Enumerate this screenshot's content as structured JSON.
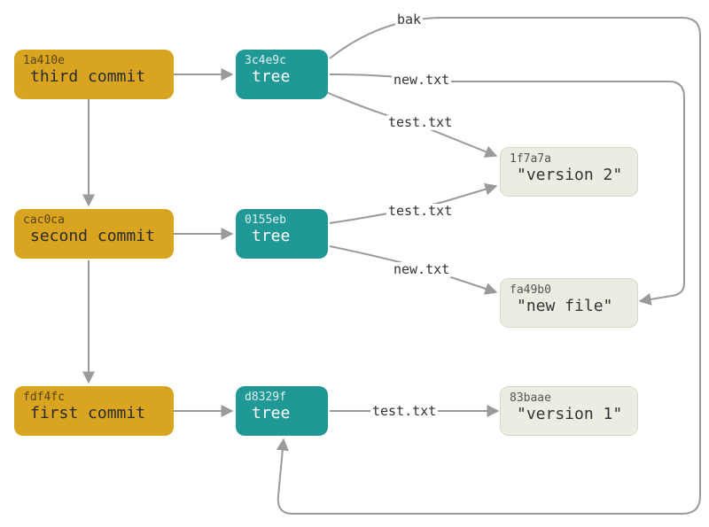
{
  "colors": {
    "commit": "#d9a521",
    "tree": "#209896",
    "blob": "#ecece3",
    "arrow": "#9a9a9a"
  },
  "nodes": {
    "commit3": {
      "hash": "1a410e",
      "title": "third commit"
    },
    "commit2": {
      "hash": "cac0ca",
      "title": "second commit"
    },
    "commit1": {
      "hash": "fdf4fc",
      "title": "first commit"
    },
    "tree3": {
      "hash": "3c4e9c",
      "title": "tree"
    },
    "tree2": {
      "hash": "0155eb",
      "title": "tree"
    },
    "tree1": {
      "hash": "d8329f",
      "title": "tree"
    },
    "blob_v2": {
      "hash": "1f7a7a",
      "title": "\"version 2\""
    },
    "blob_nf": {
      "hash": "fa49b0",
      "title": "\"new file\""
    },
    "blob_v1": {
      "hash": "83baae",
      "title": "\"version 1\""
    }
  },
  "labels": {
    "bak": "bak",
    "new_txt": "new.txt",
    "test_txt": "test.txt"
  }
}
